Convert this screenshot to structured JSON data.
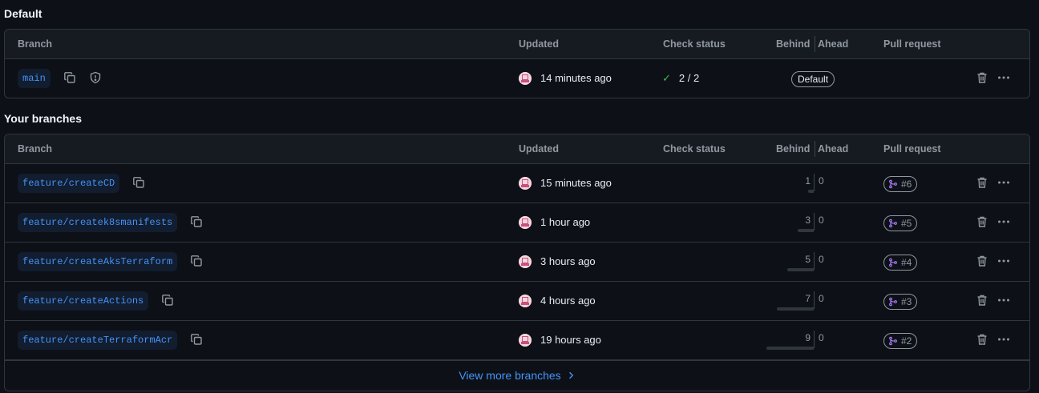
{
  "default_section": {
    "title": "Default",
    "columns": {
      "branch": "Branch",
      "updated": "Updated",
      "check_status": "Check status",
      "behind": "Behind",
      "ahead": "Ahead",
      "pull_request": "Pull request"
    },
    "row": {
      "branch": "main",
      "updated": "14 minutes ago",
      "check_status": "2 / 2",
      "badge": "Default"
    }
  },
  "your_branches": {
    "title": "Your branches",
    "columns": {
      "branch": "Branch",
      "updated": "Updated",
      "check_status": "Check status",
      "behind": "Behind",
      "ahead": "Ahead",
      "pull_request": "Pull request"
    },
    "rows": [
      {
        "branch": "feature/createCD",
        "updated": "15 minutes ago",
        "behind": "1",
        "ahead": "0",
        "pr": "#6"
      },
      {
        "branch": "feature/createk8smanifests",
        "updated": "1 hour ago",
        "behind": "3",
        "ahead": "0",
        "pr": "#5"
      },
      {
        "branch": "feature/createAksTerraform",
        "updated": "3 hours ago",
        "behind": "5",
        "ahead": "0",
        "pr": "#4"
      },
      {
        "branch": "feature/createActions",
        "updated": "4 hours ago",
        "behind": "7",
        "ahead": "0",
        "pr": "#3"
      },
      {
        "branch": "feature/createTerraformAcr",
        "updated": "19 hours ago",
        "behind": "9",
        "ahead": "0",
        "pr": "#2"
      }
    ],
    "view_more": "View more branches"
  },
  "colors": {
    "link": "#4493f8",
    "success": "#3fb950",
    "pr_merged": "#ab7df8",
    "background": "#0d1117"
  },
  "icons": {
    "copy": "copy-icon",
    "shield": "shield-icon",
    "check": "check-icon",
    "pr": "git-pull-request-icon",
    "trash": "trash-icon",
    "more": "kebab-horizontal-icon",
    "chevron": "chevron-right-icon"
  }
}
